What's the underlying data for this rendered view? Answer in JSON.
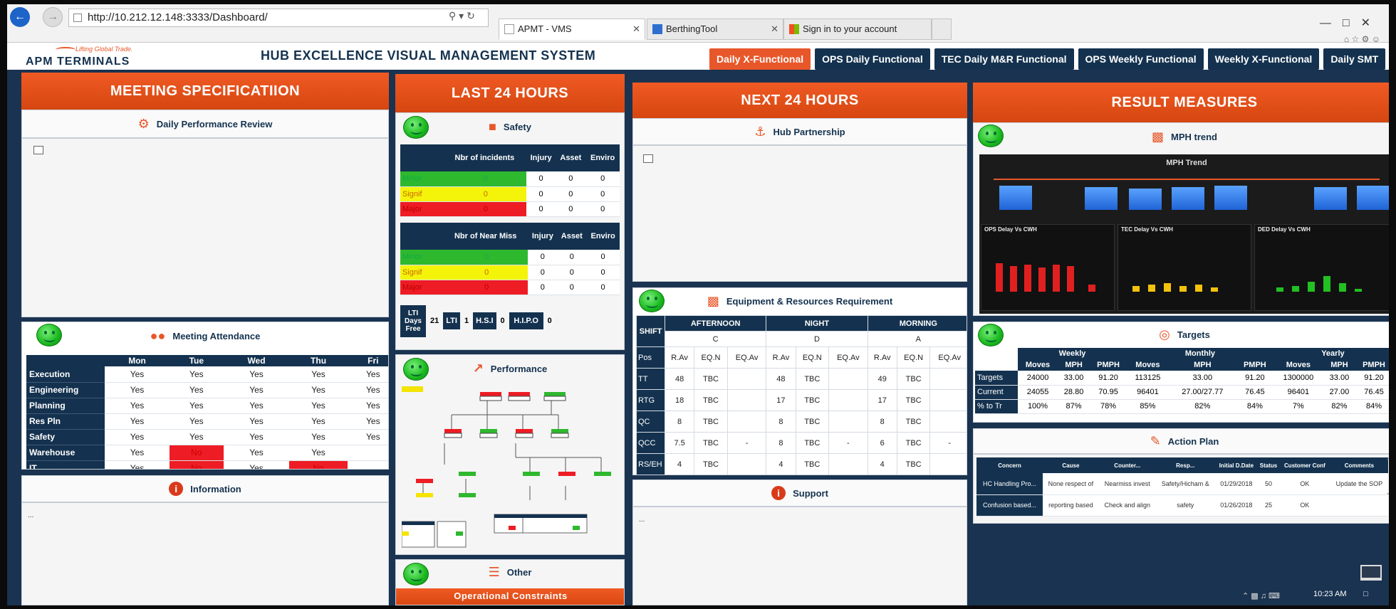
{
  "browser": {
    "url": "http://10.212.12.148:3333/Dashboard/",
    "tabs": [
      {
        "label": "APMT - VMS",
        "active": true
      },
      {
        "label": "BerthingTool",
        "active": false
      },
      {
        "label": "Sign in to your account",
        "active": false
      }
    ]
  },
  "header": {
    "logo_tagline": "Lifting Global Trade.",
    "logo_name": "APM TERMINALS",
    "title": "HUB EXCELLENCE VISUAL MANAGEMENT SYSTEM",
    "nav": [
      {
        "label": "Daily X-Functional",
        "active": true
      },
      {
        "label": "OPS Daily Functional",
        "active": false
      },
      {
        "label": "TEC Daily M&R Functional",
        "active": false
      },
      {
        "label": "OPS Weekly Functional",
        "active": false
      },
      {
        "label": "Weekly X-Functional",
        "active": false
      },
      {
        "label": "Daily SMT",
        "active": false
      }
    ]
  },
  "meeting_spec": {
    "title": "MEETING SPECIFICATIION",
    "daily_review": "Daily Performance Review",
    "attendance_title": "Meeting Attendance",
    "days": [
      "Mon",
      "Tue",
      "Wed",
      "Thu",
      "Fri"
    ],
    "rows": [
      {
        "name": "Execution",
        "vals": [
          "Yes",
          "Yes",
          "Yes",
          "Yes",
          "Yes"
        ]
      },
      {
        "name": "Engineering",
        "vals": [
          "Yes",
          "Yes",
          "Yes",
          "Yes",
          "Yes"
        ]
      },
      {
        "name": "Planning",
        "vals": [
          "Yes",
          "Yes",
          "Yes",
          "Yes",
          "Yes"
        ]
      },
      {
        "name": "Res Pln",
        "vals": [
          "Yes",
          "Yes",
          "Yes",
          "Yes",
          "Yes"
        ]
      },
      {
        "name": "Safety",
        "vals": [
          "Yes",
          "Yes",
          "Yes",
          "Yes",
          "Yes"
        ]
      },
      {
        "name": "Warehouse",
        "vals": [
          "Yes",
          "No",
          "Yes",
          "Yes",
          ""
        ]
      },
      {
        "name": "IT",
        "vals": [
          "Yes",
          "No",
          "Yes",
          "No",
          ""
        ]
      }
    ],
    "information_title": "Information",
    "information_text": "..."
  },
  "last24": {
    "title": "LAST 24 HOURS",
    "safety_title": "Safety",
    "incidents_head": [
      "",
      "Nbr of incidents",
      "Injury",
      "Asset",
      "Enviro"
    ],
    "incidents_rows": [
      {
        "label": "Minor",
        "vals": [
          "0",
          "0",
          "0",
          "0"
        ]
      },
      {
        "label": "Signif",
        "vals": [
          "0",
          "0",
          "0",
          "0"
        ]
      },
      {
        "label": "Major",
        "vals": [
          "0",
          "0",
          "0",
          "0"
        ]
      }
    ],
    "nearmiss_head": [
      "",
      "Nbr of Near Miss",
      "Injury",
      "Asset",
      "Enviro"
    ],
    "nearmiss_rows": [
      {
        "label": "Minor",
        "vals": [
          "0",
          "0",
          "0",
          "0"
        ]
      },
      {
        "label": "Signif",
        "vals": [
          "0",
          "0",
          "0",
          "0"
        ]
      },
      {
        "label": "Major",
        "vals": [
          "0",
          "0",
          "0",
          "0"
        ]
      }
    ],
    "lti_label": "LTI Days Free",
    "lti_days": "21",
    "lti": "LTI",
    "lti_val": "1",
    "hsi": "H.S.I",
    "hsi_val": "0",
    "hip": "H.I.P.O",
    "hip_val": "0",
    "performance_title": "Performance",
    "other_title": "Other",
    "constraints_title": "Operational Constraints"
  },
  "next24": {
    "title": "NEXT 24 HOURS",
    "hub_title": "Hub Partnership",
    "equip_title": "Equipment & Resources Requirement",
    "shift_label": "SHIFT",
    "shifts": [
      {
        "name": "AFTERNOON",
        "code": "C"
      },
      {
        "name": "NIGHT",
        "code": "D"
      },
      {
        "name": "MORNING",
        "code": "A"
      }
    ],
    "sub_cols": [
      "R.Av",
      "EQ.N",
      "EQ.Av"
    ],
    "pos_label": "Pos",
    "rows": [
      {
        "label": "TT",
        "vals": [
          "48",
          "TBC",
          "",
          "48",
          "TBC",
          "",
          "49",
          "TBC",
          ""
        ]
      },
      {
        "label": "RTG",
        "vals": [
          "18",
          "TBC",
          "",
          "17",
          "TBC",
          "",
          "17",
          "TBC",
          ""
        ]
      },
      {
        "label": "QC",
        "vals": [
          "8",
          "TBC",
          "",
          "8",
          "TBC",
          "",
          "8",
          "TBC",
          ""
        ]
      },
      {
        "label": "QCC",
        "vals": [
          "7.5",
          "TBC",
          "-",
          "8",
          "TBC",
          "-",
          "6",
          "TBC",
          "-"
        ]
      },
      {
        "label": "RS/EH",
        "vals": [
          "4",
          "TBC",
          "",
          "4",
          "TBC",
          "",
          "4",
          "TBC",
          ""
        ]
      }
    ],
    "support_title": "Support",
    "support_text": "..."
  },
  "results": {
    "title": "RESULT MEASURES",
    "mph_title": "MPH trend",
    "mph_chart_title": "MPH Trend",
    "ops_delay": "OPS Delay Vs CWH",
    "tec_delay": "TEC Delay Vs CWH",
    "ded_delay": "DED Delay Vs CWH",
    "targets_title": "Targets",
    "periods": [
      "Weekly",
      "Monthly",
      "Yearly"
    ],
    "metrics": [
      "Moves",
      "MPH",
      "PMPH"
    ],
    "target_rows": [
      {
        "label": "Targets",
        "vals": [
          "24000",
          "33.00",
          "91.20",
          "113125",
          "33.00",
          "91.20",
          "1300000",
          "33.00",
          "91.20"
        ]
      },
      {
        "label": "Current",
        "vals": [
          "24055",
          "28.80",
          "70.95",
          "96401",
          "27.00/27.77",
          "76.45",
          "96401",
          "27.00",
          "76.45"
        ]
      },
      {
        "label": "% to Tr",
        "vals": [
          "100%",
          "87%",
          "78%",
          "85%",
          "82%",
          "84%",
          "7%",
          "82%",
          "84%"
        ]
      }
    ],
    "action_title": "Action Plan",
    "action_cols": [
      "Concern",
      "Cause",
      "Counter...",
      "Resp...",
      "Initial D.Date",
      "Status",
      "Customer Conf",
      "Comments"
    ],
    "action_rows": [
      [
        "HC Handling Pro...",
        "None respect of",
        "Nearmiss invest",
        "Safety/Hicham &",
        "01/29/2018",
        "50",
        "OK",
        "Update the SOP"
      ],
      [
        "Confusion based...",
        "reporting based",
        "Check and align",
        "safety",
        "01/26/2018",
        "25",
        "OK",
        ""
      ]
    ]
  },
  "taskbar": {
    "time": "10:23 AM"
  }
}
